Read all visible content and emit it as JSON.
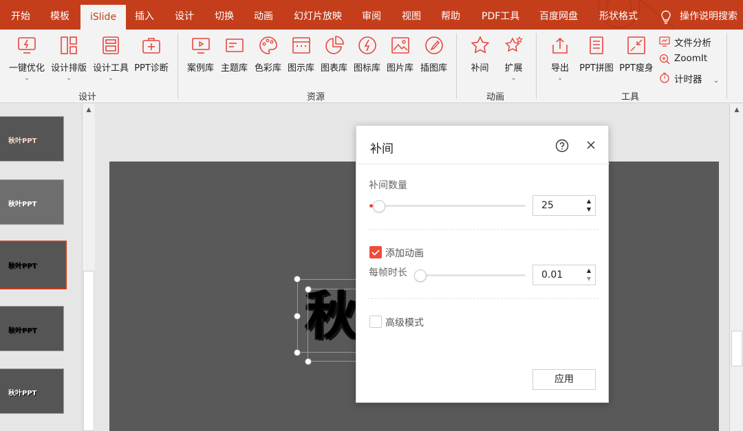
{
  "tabs": [
    {
      "label": "开始",
      "active": false
    },
    {
      "label": "模板",
      "active": false
    },
    {
      "label": "iSlide",
      "active": true
    },
    {
      "label": "插入",
      "active": false
    },
    {
      "label": "设计",
      "active": false
    },
    {
      "label": "切换",
      "active": false
    },
    {
      "label": "动画",
      "active": false
    },
    {
      "label": "幻灯片放映",
      "active": false
    },
    {
      "label": "审阅",
      "active": false
    },
    {
      "label": "视图",
      "active": false
    },
    {
      "label": "帮助",
      "active": false
    },
    {
      "label": "PDF工具",
      "active": false
    },
    {
      "label": "百度网盘",
      "active": false
    },
    {
      "label": "形状格式",
      "active": false
    }
  ],
  "tell_me": "操作说明搜索",
  "ribbon": {
    "design": {
      "group_label": "设计",
      "buttons": [
        {
          "label": "一键优化",
          "icon": "monitor-lightning-icon",
          "has_dropdown": true
        },
        {
          "label": "设计排版",
          "icon": "layout-grid-icon",
          "has_dropdown": true
        },
        {
          "label": "设计工具",
          "icon": "design-tools-icon",
          "has_dropdown": true
        },
        {
          "label": "PPT诊断",
          "icon": "medical-kit-icon",
          "has_dropdown": false
        }
      ]
    },
    "resources": {
      "group_label": "资源",
      "buttons": [
        {
          "label": "案例库",
          "icon": "presentation-icon"
        },
        {
          "label": "主题库",
          "icon": "theme-icon"
        },
        {
          "label": "色彩库",
          "icon": "palette-icon"
        },
        {
          "label": "图示库",
          "icon": "diagram-icon"
        },
        {
          "label": "图表库",
          "icon": "pie-chart-icon"
        },
        {
          "label": "图标库",
          "icon": "lightning-circle-icon"
        },
        {
          "label": "图片库",
          "icon": "image-icon"
        },
        {
          "label": "插图库",
          "icon": "brush-icon"
        }
      ]
    },
    "animation": {
      "group_label": "动画",
      "buttons": [
        {
          "label": "补间",
          "icon": "star-icon",
          "has_dropdown": false
        },
        {
          "label": "扩展",
          "icon": "stars-icon",
          "has_dropdown": true
        }
      ]
    },
    "tools": {
      "group_label": "工具",
      "buttons": [
        {
          "label": "导出",
          "icon": "export-icon",
          "has_dropdown": true
        },
        {
          "label": "PPT拼图",
          "icon": "collage-icon"
        },
        {
          "label": "PPT瘦身",
          "icon": "compress-icon"
        }
      ],
      "small": [
        {
          "label": "文件分析",
          "icon": "file-analysis-icon"
        },
        {
          "label": "ZoomIt",
          "icon": "zoom-icon"
        },
        {
          "label": "计时器",
          "icon": "timer-icon"
        }
      ]
    }
  },
  "thumbnails": [
    {
      "text": "秋叶PPT",
      "selected": false
    },
    {
      "text": "秋叶PPT",
      "selected": false
    },
    {
      "text": "秋叶PPT",
      "selected": true
    },
    {
      "text": "秋叶PPT",
      "selected": false
    },
    {
      "text": "秋叶PPT",
      "selected": false
    }
  ],
  "slide": {
    "big_char": "秋"
  },
  "dialog": {
    "title": "补间",
    "tween_count_label": "补间数量",
    "tween_count_value": "25",
    "add_animation_label": "添加动画",
    "add_animation_checked": true,
    "frame_duration_label": "每帧时长",
    "frame_duration_value": "0.01",
    "advanced_label": "高级模式",
    "advanced_checked": false,
    "apply_label": "应用"
  },
  "colors": {
    "accent": "#c43e1c",
    "checkbox": "#f04b3a",
    "icon_red": "#e8453c"
  }
}
